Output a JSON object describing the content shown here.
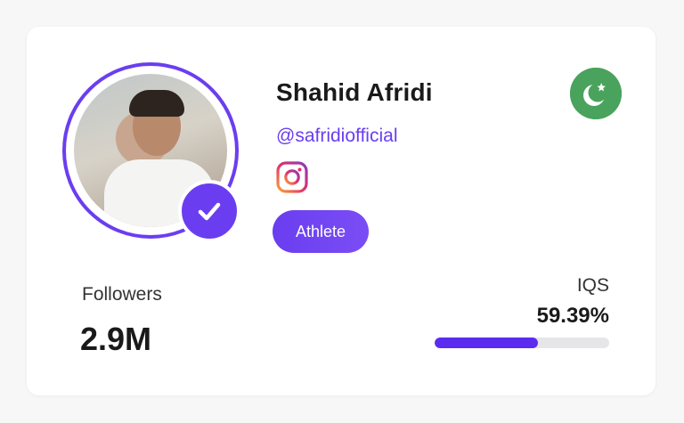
{
  "profile": {
    "name": "Shahid Afridi",
    "handle": "@safridiofficial",
    "category": "Athlete",
    "verified": true,
    "country_flag_icon": "pakistan-flag-icon",
    "social_icon": "instagram-icon"
  },
  "stats": {
    "followers_label": "Followers",
    "followers_value": "2.9M",
    "iqs_label": "IQS",
    "iqs_value": "59.39%",
    "iqs_fraction": 0.5939
  },
  "colors": {
    "accent": "#6a3ef0",
    "flag_green": "#4aa35d",
    "bar_fill": "#5b2cf0",
    "bar_track": "#e6e6e9"
  }
}
